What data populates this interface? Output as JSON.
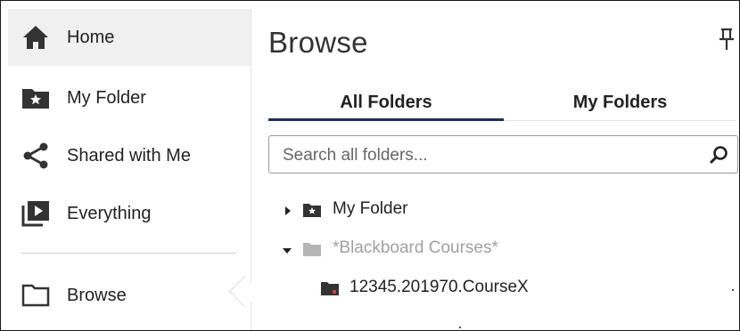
{
  "sidebar": {
    "items": [
      {
        "label": "Home",
        "icon": "home-icon",
        "active": true
      },
      {
        "label": "My Folder",
        "icon": "star-folder-icon"
      },
      {
        "label": "Shared with Me",
        "icon": "share-icon"
      },
      {
        "label": "Everything",
        "icon": "play-library-icon"
      },
      {
        "label": "Browse",
        "icon": "folder-outline-icon"
      }
    ]
  },
  "main": {
    "title": "Browse",
    "pin_icon": "pin-icon",
    "tabs": [
      {
        "label": "All Folders",
        "selected": true
      },
      {
        "label": "My Folders",
        "selected": false
      }
    ],
    "search": {
      "placeholder": "Search all folders...",
      "value": "",
      "icon": "search-icon"
    },
    "tree": [
      {
        "label": "My Folder",
        "expanded": false,
        "icon": "star-folder-icon"
      },
      {
        "label": "*Blackboard Courses*",
        "expanded": true,
        "icon": "folder-icon",
        "muted": true
      },
      {
        "label": "12345.201970.CourseX",
        "icon": "course-folder-icon"
      }
    ]
  },
  "colors": {
    "active_bg": "#f0f0f0",
    "tab_underline": "#1c2f5a",
    "icon_dark": "#333333",
    "muted_text": "#a0a0a0",
    "course_marker": "#e23a2a"
  }
}
